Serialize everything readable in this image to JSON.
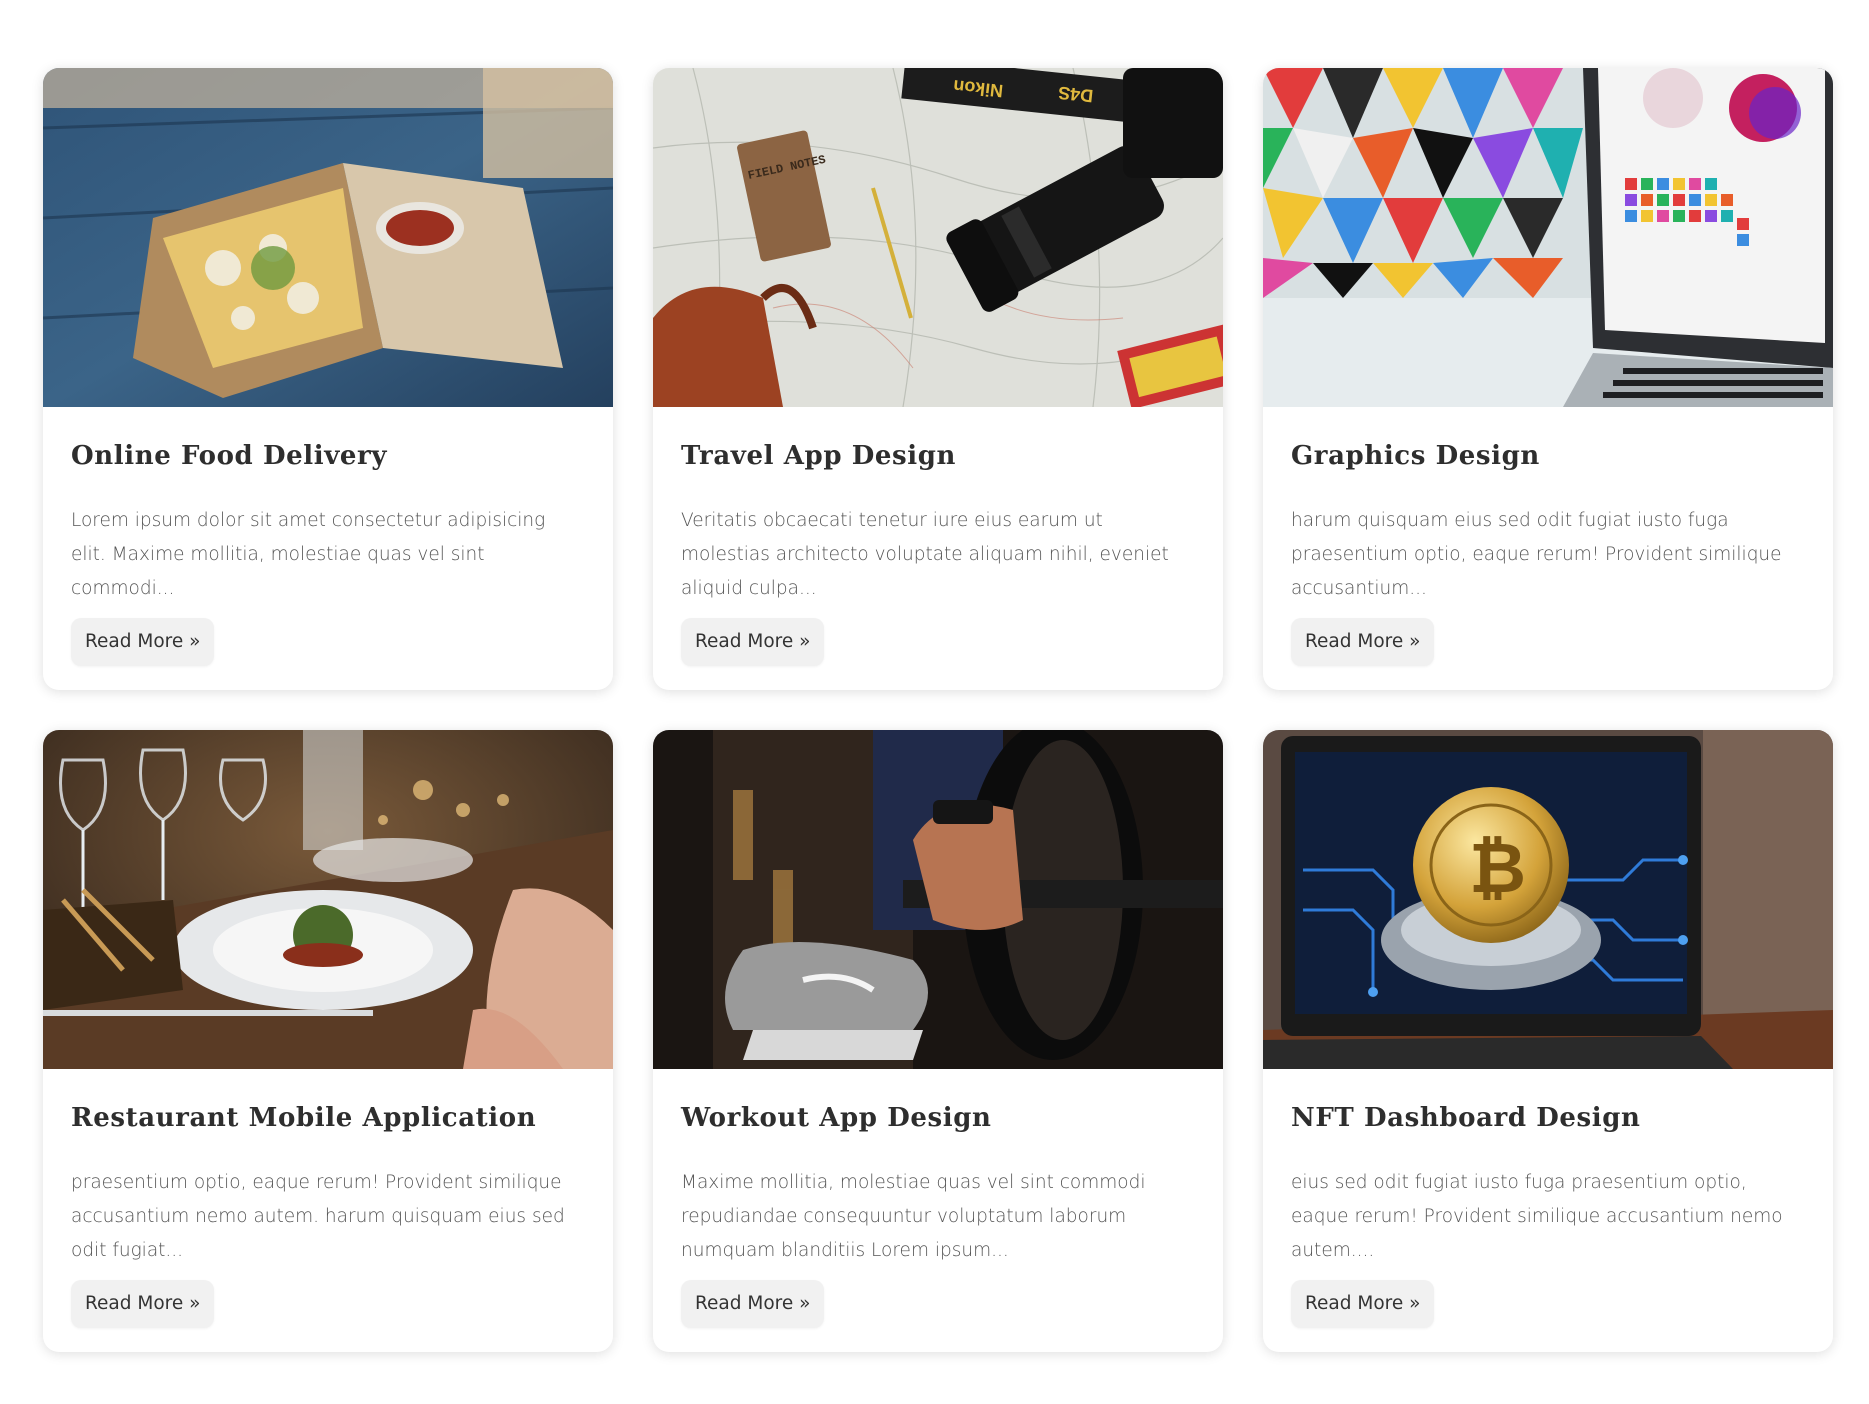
{
  "cards": [
    {
      "title": "Online Food Delivery",
      "text": "Lorem ipsum dolor sit amet consectetur adipisicing elit. Maxime mollitia, molestiae quas vel sint commodi...",
      "button": "Read More »",
      "image_icon": "food-image"
    },
    {
      "title": "Travel App Design",
      "text": "Veritatis obcaecati tenetur iure eius earum ut molestias architecto voluptate aliquam nihil, eveniet aliquid culpa...",
      "button": "Read More »",
      "image_icon": "travel-image"
    },
    {
      "title": "Graphics Design",
      "text": "harum quisquam eius sed odit fugiat iusto fuga praesentium optio, eaque rerum! Provident similique accusantium...",
      "button": "Read More »",
      "image_icon": "graphics-image"
    },
    {
      "title": "Restaurant Mobile Application",
      "text": "praesentium optio, eaque rerum! Provident similique accusantium nemo autem. harum quisquam eius sed odit fugiat...",
      "button": "Read More »",
      "image_icon": "restaurant-image"
    },
    {
      "title": "Workout App Design",
      "text": "Maxime mollitia, molestiae quas vel sint commodi repudiandae consequuntur voluptatum laborum numquam blanditiis Lorem ipsum...",
      "button": "Read More »",
      "image_icon": "workout-image"
    },
    {
      "title": "NFT Dashboard Design",
      "text": "eius sed odit fugiat iusto fuga praesentium optio, eaque rerum! Provident similique accusantium nemo autem....",
      "button": "Read More »",
      "image_icon": "nft-image"
    }
  ],
  "image_text": {
    "field_notes": "FIELD NOTES",
    "strap_left": "Nikon",
    "strap_right": "D4S"
  }
}
